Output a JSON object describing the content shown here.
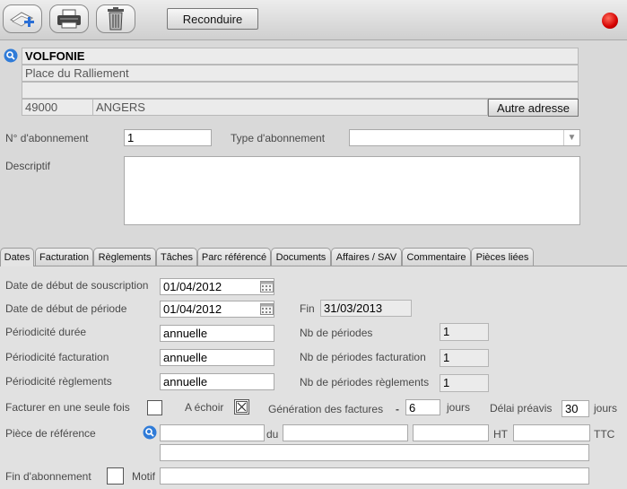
{
  "toolbar": {
    "new_icon": "new-document-icon",
    "print_icon": "printer-icon",
    "delete_icon": "trash-icon",
    "reconduire_label": "Reconduire",
    "status_color": "#d40000"
  },
  "client": {
    "name": "VOLFONIE",
    "address1": "Place du Ralliement",
    "address2": "",
    "postal_code": "49000",
    "city": "ANGERS",
    "other_address_label": "Autre adresse"
  },
  "form": {
    "num_label": "N° d'abonnement",
    "num_value": "1",
    "type_label": "Type d'abonnement",
    "type_value": "",
    "desc_label": "Descriptif",
    "desc_value": ""
  },
  "tabs": [
    "Dates",
    "Facturation",
    "Règlements",
    "Tâches",
    "Parc référencé",
    "Documents",
    "Affaires / SAV",
    "Commentaire",
    "Pièces liées"
  ],
  "dates": {
    "souscription_label": "Date de début de souscription",
    "souscription_value": "01/04/2012",
    "periode_label": "Date de début de période",
    "periode_value": "01/04/2012",
    "fin_label": "Fin",
    "fin_value": "31/03/2013",
    "duree_label": "Périodicité durée",
    "duree_value": "annuelle",
    "facturation_label": "Périodicité facturation",
    "facturation_value": "annuelle",
    "reglements_label": "Périodicité règlements",
    "reglements_value": "annuelle",
    "nb_periodes_label": "Nb de périodes",
    "nb_periodes_value": "1",
    "nb_fact_label": "Nb de périodes facturation",
    "nb_fact_value": "1",
    "nb_regl_label": "Nb de périodes règlements",
    "nb_regl_value": "1",
    "seule_fois_label": "Facturer en une seule fois",
    "echoir_label": "A échoir",
    "generation_label": "Génération des factures",
    "minus": "-",
    "generation_value": "6",
    "jours1": "jours",
    "preavis_label": "Délai préavis",
    "preavis_value": "30",
    "jours2": "jours",
    "piece_label": "Pièce de référence",
    "du_label": "du",
    "ht_label": "HT",
    "ttc_label": "TTC",
    "fin_abonnement_label": "Fin d'abonnement",
    "motif_label": "Motif"
  }
}
